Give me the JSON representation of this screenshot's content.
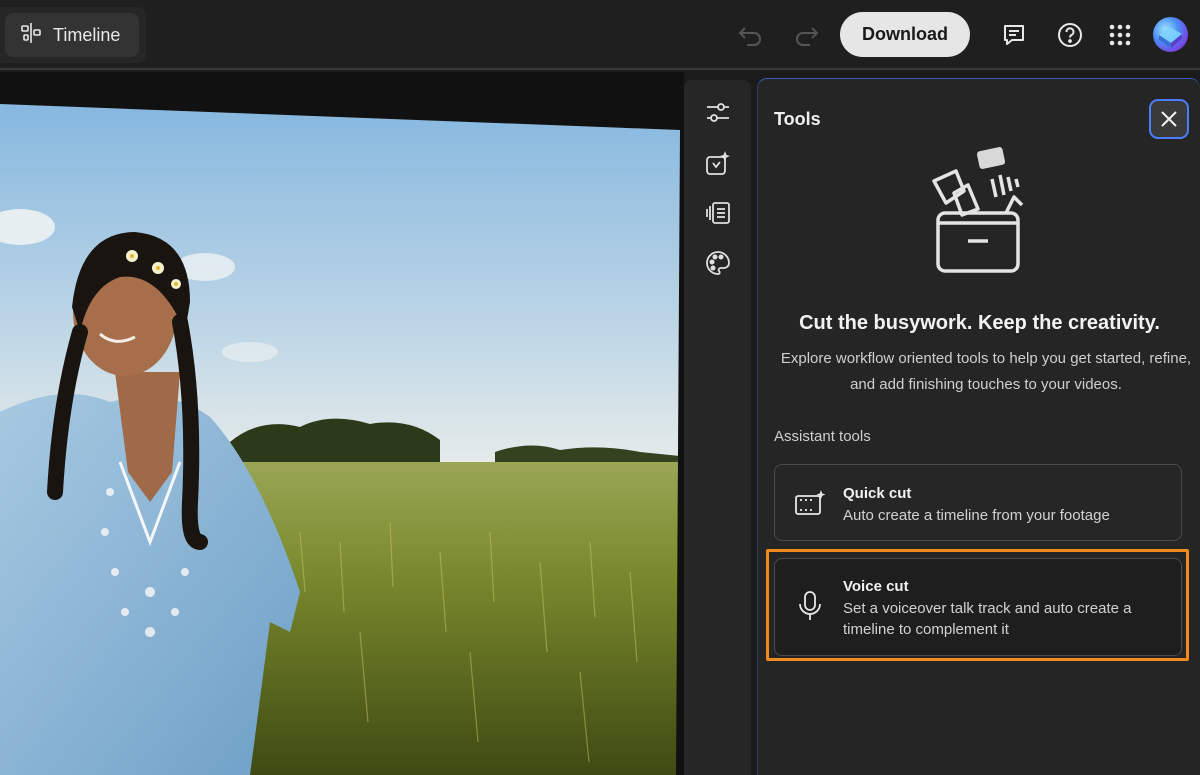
{
  "topbar": {
    "timeline_label": "Timeline",
    "download_label": "Download"
  },
  "panel": {
    "title": "Tools",
    "headline": "Cut the busywork. Keep the creativity.",
    "subtext": "Explore workflow oriented tools to help you get started, refine, and add finishing touches to your videos.",
    "section_label": "Assistant tools",
    "tools": [
      {
        "title": "Quick cut",
        "description": "Auto create a timeline from your footage",
        "icon": "quick-cut-icon"
      },
      {
        "title": "Voice cut",
        "description": "Set a voiceover talk track and auto create a timeline to complement it",
        "icon": "microphone-icon"
      }
    ]
  },
  "rail": {
    "icons": [
      "adjustments-sliders-icon",
      "magic-cut-icon",
      "captions-icon",
      "color-palette-icon"
    ]
  },
  "colors": {
    "background": "#1b1b1b",
    "panel": "#252525",
    "focus_ring": "#4d7dff",
    "highlight": "#f08a1e",
    "download_bg": "#e6e6e6"
  }
}
